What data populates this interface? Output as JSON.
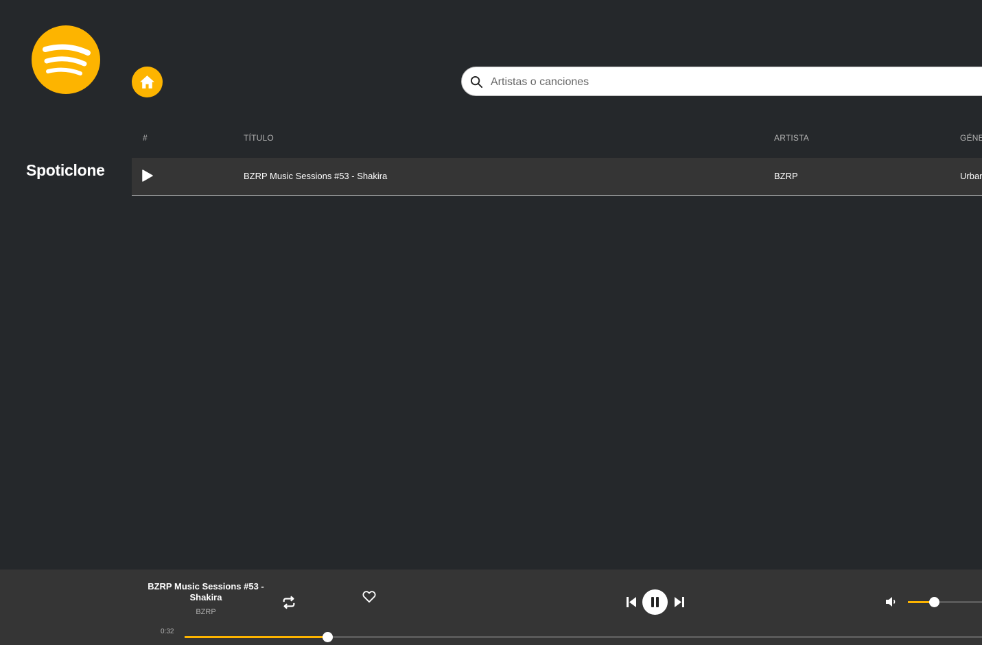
{
  "app": {
    "name": "Spoticlone",
    "accent_color": "#fdb400",
    "logo_icon": "spotify-logo-icon",
    "home_icon": "home-icon"
  },
  "search": {
    "placeholder": "Artistas o canciones",
    "value": ""
  },
  "table": {
    "headers": [
      "#",
      "TÍTULO",
      "ARTISTA",
      "GÉNERO"
    ],
    "rows": [
      {
        "index_icon": "play-icon",
        "title": "BZRP Music Sessions #53 - Shakira",
        "artist": "BZRP",
        "genre": "Urbano"
      }
    ]
  },
  "player": {
    "track_title": "BZRP Music Sessions #53 - Shakira",
    "track_artist": "BZRP",
    "elapsed": "0:32",
    "progress_fraction": 0.178,
    "volume_fraction": 0.32,
    "state": "playing",
    "icons": [
      "repeat-icon",
      "heart-icon",
      "previous-icon",
      "pause-icon",
      "next-icon",
      "volume-icon"
    ]
  }
}
